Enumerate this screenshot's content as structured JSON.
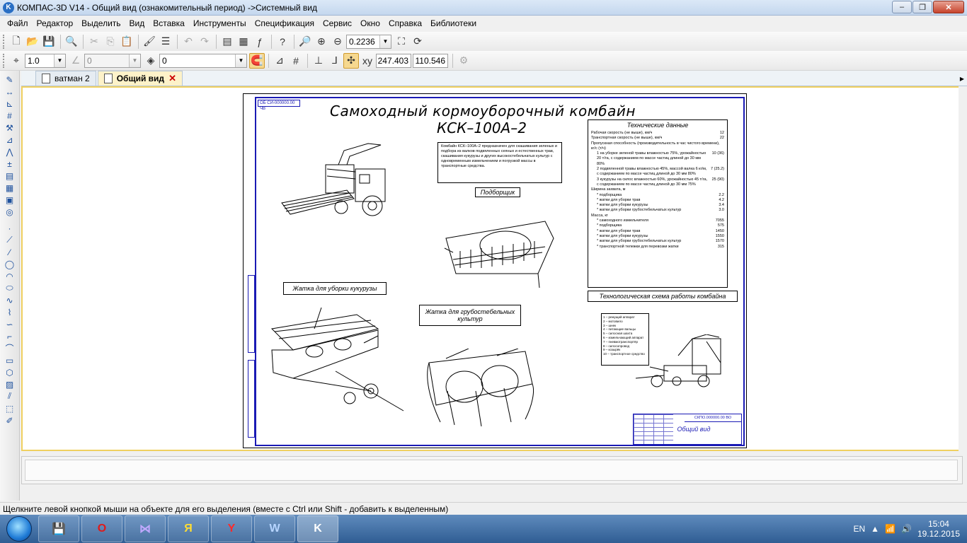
{
  "window": {
    "title": "КОМПАС-3D V14 - Общий вид (ознакомительный период) ->Системный вид",
    "minimize": "–",
    "maximize": "❐",
    "close": "✕"
  },
  "menu": [
    "Файл",
    "Редактор",
    "Выделить",
    "Вид",
    "Вставка",
    "Инструменты",
    "Спецификация",
    "Сервис",
    "Окно",
    "Справка",
    "Библиотеки"
  ],
  "toolbar1": {
    "zoom_value": "0.2236"
  },
  "toolbar2": {
    "step_value": "1.0",
    "angle_value": "0",
    "layer_value": "0",
    "coord_x": "247.403",
    "coord_y": "110.546"
  },
  "tabs": [
    {
      "label": "ватман 2",
      "active": false
    },
    {
      "label": "Общий вид",
      "active": true
    }
  ],
  "drawing": {
    "stamp_code": "ОБ СИ-000000.00 ЧВ",
    "title": "Самоходный кормоуборочный комбайн",
    "subtitle": "КСК–100А–2",
    "description": "Комбайн КСК–100А–2 предназначен для скашивания зеленых и подбора из валков подвяленных сеяных и естественных трав, скашивания кукурузы и других высокостебельчатых культур с одновременным измельчением и погрузкой массы в транспортные средства.",
    "tech": {
      "title": "Технические данные",
      "rows": [
        {
          "k": "Рабочая скорость (не выше), км/ч",
          "v": "12",
          "ind": false
        },
        {
          "k": "Транспортная скорость (не выше), км/ч",
          "v": "22",
          "ind": false
        },
        {
          "k": "Пропускная способность (производительность в час чистого времени), кг/с (т/ч)",
          "v": "",
          "ind": false
        },
        {
          "k": "1 на уборке зеленой травы влажностью 75%, урожайностью 20 т/га, с содержанием по массе частиц длиной до 30 мм 80%",
          "v": "10 (36)",
          "ind": true
        },
        {
          "k": "2 подвяленной травы влажностью 45%, массой валка 6 кг/м, с содержанием по массе частиц длиной до 30 мм 80%",
          "v": "7 (25.2)",
          "ind": true
        },
        {
          "k": "3 кукурузы на силос влажностью 60%, урожайностью 45 т/га, с содержанием по массе частиц длиной до 30 мм 75%",
          "v": "25 (90)",
          "ind": true
        },
        {
          "k": "Ширина захвата, м",
          "v": "",
          "ind": false
        },
        {
          "k": "* подборщика",
          "v": "2.2",
          "ind": true
        },
        {
          "k": "* жатки для уборки трав",
          "v": "4.2",
          "ind": true
        },
        {
          "k": "* жатки для уборки кукурузы",
          "v": "3.4",
          "ind": true
        },
        {
          "k": "* жатки для уборки грубостебельчатых культур",
          "v": "3.0",
          "ind": true
        },
        {
          "k": "Масса, кг",
          "v": "",
          "ind": false
        },
        {
          "k": "* самоходного измельчителя",
          "v": "7055",
          "ind": true
        },
        {
          "k": "* подборщика",
          "v": "575",
          "ind": true
        },
        {
          "k": "* жатки для уборки трав",
          "v": "1450",
          "ind": true
        },
        {
          "k": "* жатки для уборки кукурузы",
          "v": "1550",
          "ind": true
        },
        {
          "k": "* жатки для уборки грубостебельчатых культур",
          "v": "1570",
          "ind": true
        },
        {
          "k": "* транспортной тележки для перевозки жатки",
          "v": "315",
          "ind": true
        }
      ]
    },
    "captions": {
      "pickup": "Подборщик",
      "corn_header": "Жатка для уборки кукурузы",
      "coarse_header": "Жатка для грубостебельных культур",
      "scheme": "Технологическая схема работы комбайна"
    },
    "legend": [
      "1 – режущий аппарат",
      "2 – мотовило",
      "3 – шнек",
      "4 – питающие вальцы",
      "5 – силосная шахта",
      "6 – измельчающий аппарат",
      "7 – пневмотранспортёр",
      "8 – силосопровод",
      "9 – козырёк",
      "10 – транспортное средство"
    ],
    "titleblock": {
      "code": "СКПО.000000.00 ВО",
      "name": "Общий вид"
    }
  },
  "status": "Щелкните левой кнопкой мыши на объекте для его выделения (вместе с Ctrl или Shift - добавить к выделенным)",
  "taskbar": {
    "apps": [
      "💾",
      "O",
      "⋈",
      "Я",
      "Y",
      "W",
      "K"
    ],
    "lang": "EN",
    "time": "15:04",
    "date": "19.12.2015"
  },
  "colors": {
    "frame_blue": "#1a1ab4",
    "workspace_border": "#f0d060"
  }
}
